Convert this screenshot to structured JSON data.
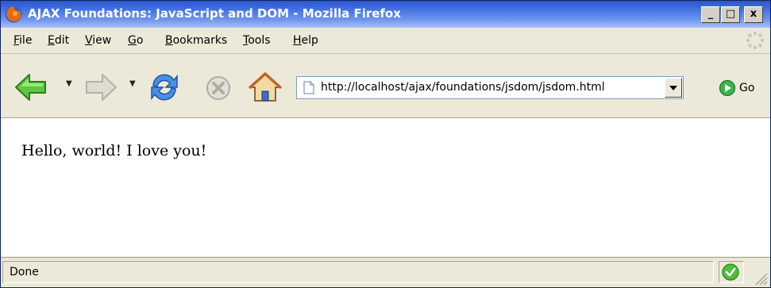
{
  "window": {
    "title": "AJAX Foundations: JavaScript and DOM - Mozilla Firefox",
    "controls": {
      "minimize": "_",
      "maximize": "□",
      "close": "x"
    }
  },
  "menubar": {
    "items": [
      {
        "accel": "F",
        "rest": "ile"
      },
      {
        "accel": "E",
        "rest": "dit"
      },
      {
        "accel": "V",
        "rest": "iew"
      },
      {
        "accel": "G",
        "rest": "o"
      },
      {
        "accel": "B",
        "rest": "ookmarks"
      },
      {
        "accel": "T",
        "rest": "ools"
      },
      {
        "accel": "H",
        "rest": "elp"
      }
    ]
  },
  "toolbar": {
    "icons": [
      "back-arrow-icon",
      "forward-arrow-icon",
      "reload-icon",
      "stop-icon",
      "home-icon"
    ],
    "address_value": "http://localhost/ajax/foundations/jsdom/jsdom.html",
    "go_label": "Go"
  },
  "content": {
    "text": "Hello, world! I love you!"
  },
  "statusbar": {
    "text": "Done"
  },
  "colors": {
    "titlebar": "#3b6be0",
    "chrome": "#ece9d8",
    "back_arrow": "#4caf32",
    "reload": "#2e7cd6",
    "secure_check": "#3c9a2a"
  }
}
